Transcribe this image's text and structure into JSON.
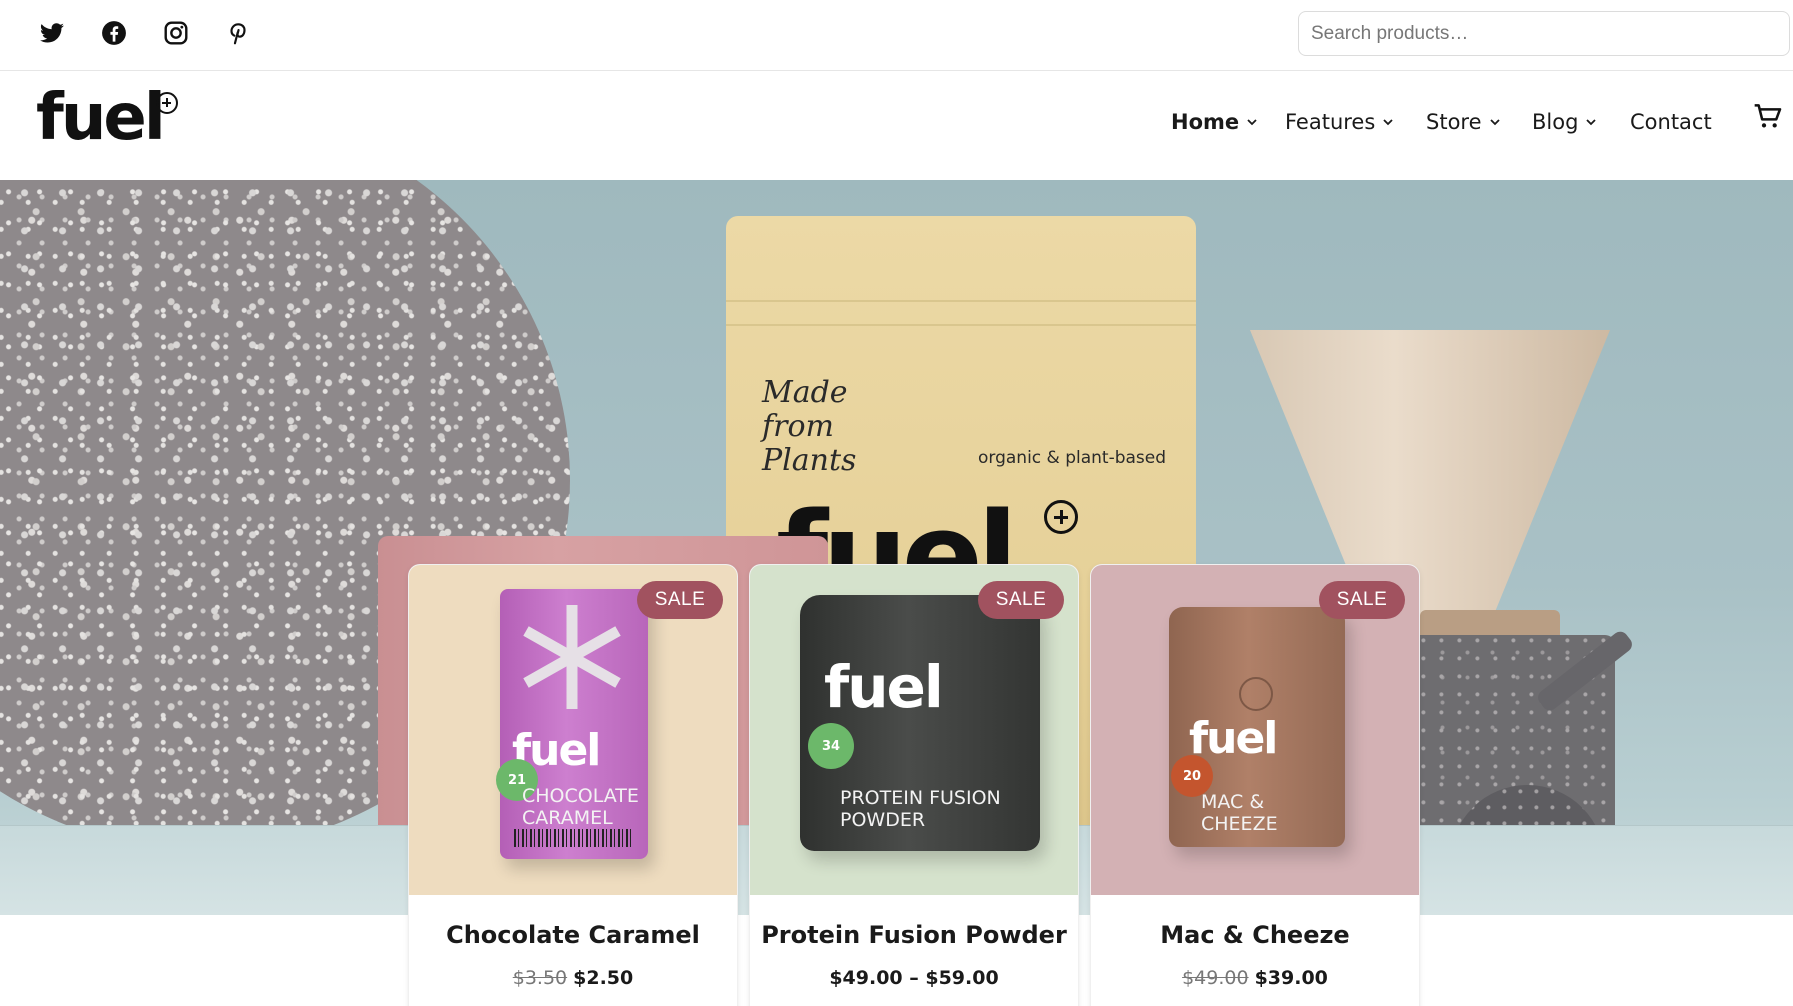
{
  "topbar": {
    "social": [
      {
        "name": "twitter-icon"
      },
      {
        "name": "facebook-icon"
      },
      {
        "name": "instagram-icon"
      },
      {
        "name": "pinterest-icon"
      }
    ],
    "search_placeholder": "Search products…"
  },
  "header": {
    "logo_text": "fuel",
    "nav": [
      {
        "label": "Home",
        "active": true,
        "dropdown": true
      },
      {
        "label": "Features",
        "active": false,
        "dropdown": true
      },
      {
        "label": "Store",
        "active": false,
        "dropdown": true
      },
      {
        "label": "Blog",
        "active": false,
        "dropdown": true
      },
      {
        "label": "Contact",
        "active": false,
        "dropdown": false
      }
    ],
    "cart_icon": "cart-icon"
  },
  "hero": {
    "pouch_script": "Made from Plants",
    "pouch_tag": "organic & plant-based",
    "pouch_brand": "fuel"
  },
  "products": [
    {
      "title": "Chocolate Caramel",
      "old_price": "$3.50",
      "price": "$2.50",
      "badge": "SALE",
      "pack_label": "CHOCOLATE CARAMEL",
      "pack_brand": "fuel",
      "pack_count": "21",
      "bg_color": "#eedcbf",
      "pack_color": "#c46fc6"
    },
    {
      "title": "Protein Fusion Powder",
      "old_price": "",
      "price": "$49.00 – $59.00",
      "badge": "SALE",
      "pack_label": "PROTEIN FUSION POWDER",
      "pack_brand": "fuel",
      "pack_count": "34",
      "bg_color": "#d5e2cc",
      "pack_color": "#3e403e"
    },
    {
      "title": "Mac & Cheeze",
      "old_price": "$49.00",
      "price": "$39.00",
      "badge": "SALE",
      "pack_label": "MAC & CHEEZE",
      "pack_brand": "fuel",
      "pack_count": "20",
      "bg_color": "#d3b1b4",
      "pack_color": "#a0735b"
    }
  ],
  "colors": {
    "sale_badge": "#a1525f",
    "hero_bg": "#a9c1c6"
  }
}
